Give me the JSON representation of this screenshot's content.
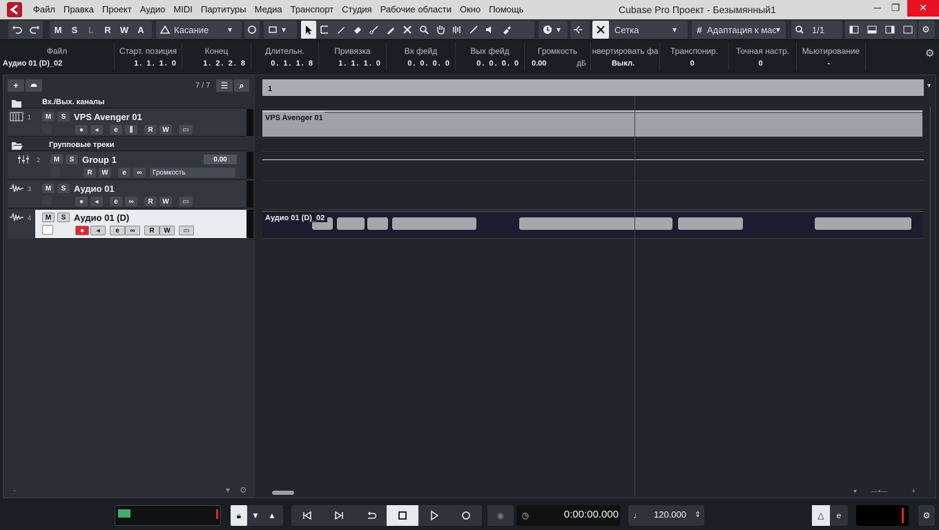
{
  "window": {
    "title": "Cubase Pro Проект - Безымянный1",
    "minimize": "─",
    "maximize": "❐",
    "close": "✕"
  },
  "menu": [
    "Файл",
    "Правка",
    "Проект",
    "Аудио",
    "MIDI",
    "Партитуры",
    "Медиа",
    "Транспорт",
    "Студия",
    "Рабочие области",
    "Окно",
    "Помощь"
  ],
  "toolbar": {
    "undo_icon": "undo-icon",
    "redo_icon": "redo-icon",
    "state_buttons": [
      "M",
      "S",
      "L",
      "R",
      "W",
      "A"
    ],
    "automation_mode": "Касание",
    "snap_type": "Сетка",
    "quantize_preset": "Адаптация к мас",
    "quantize_value": "1/1"
  },
  "infoline": {
    "columns": [
      {
        "header": "Файл",
        "value": "Аудио 01 (D)_02"
      },
      {
        "header": "Старт. позиция",
        "value": "1. 1. 1.   0"
      },
      {
        "header": "Конец",
        "value": "1. 2. 2.   8"
      },
      {
        "header": "Длительн.",
        "value": "0. 1. 1.   8"
      },
      {
        "header": "Привязка",
        "value": "1. 1. 1.   0"
      },
      {
        "header": "Вх фейд",
        "value": "0. 0. 0.   0"
      },
      {
        "header": "Вых фейд",
        "value": "0. 0. 0.   0"
      },
      {
        "header": "Громкость",
        "value": "0.00",
        "unit": "дБ"
      },
      {
        "header": "нвертировать фа",
        "value": "Выкл."
      },
      {
        "header": "Транспонир.",
        "value": "0"
      },
      {
        "header": "Точная настр.",
        "value": "0"
      },
      {
        "header": "Мьютирование",
        "value": "-"
      }
    ]
  },
  "tracklist": {
    "count": "7 / 7",
    "tracks": [
      {
        "name": "Вх./Вых. каналы",
        "type": "folder"
      },
      {
        "num": "1",
        "name": "VPS Avenger 01",
        "type": "instrument"
      },
      {
        "name": "Групповые треки",
        "type": "folder"
      },
      {
        "num": "2",
        "name": "Group 1",
        "type": "group",
        "volume": "0.00",
        "param": "Громкость"
      },
      {
        "num": "3",
        "name": "Аудио 01",
        "type": "audio"
      },
      {
        "num": "4",
        "name": "Аудио 01 (D)",
        "type": "audio",
        "selected": true
      }
    ],
    "btn_m": "M",
    "btn_s": "S",
    "btn_r": "R",
    "btn_w": "W"
  },
  "events": {
    "ruler_label": "1",
    "instrument_part": "VPS Avenger 01",
    "audio_event": "Аудио 01 (D)_02"
  },
  "transport": {
    "time": "0:00:00.000",
    "tempo": "120.000"
  },
  "colors": {
    "record": "#e0262f",
    "accent": "#e9ebee"
  }
}
